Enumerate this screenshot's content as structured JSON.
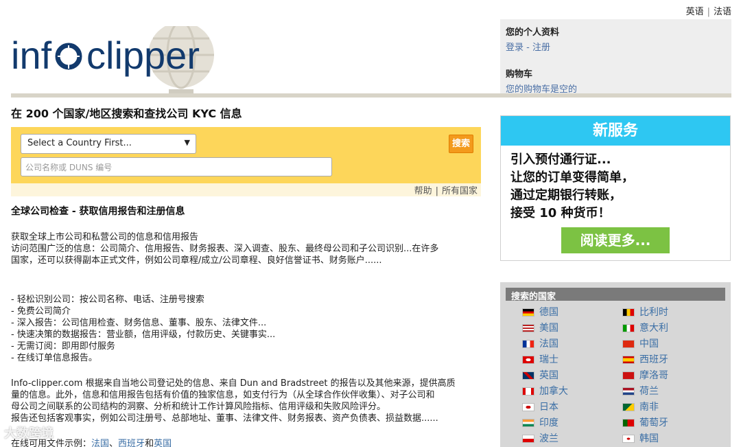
{
  "lang": {
    "english": "英语",
    "french": "法语"
  },
  "account": {
    "profile_label": "您的个人资料",
    "login": "登录",
    "register": "注册",
    "cart_label": "购物车",
    "cart_status": "您的购物车是空的"
  },
  "page_title": "在 200 个国家/地区搜索和查找公司 KYC 信息",
  "search": {
    "country_select": "Select a Country First...",
    "placeholder": "公司名称或 DUNS 编号",
    "button": "搜索",
    "help": "帮助",
    "all_countries": "所有国家"
  },
  "content": {
    "heading": "全球公司检查 - 获取信用报告和注册信息",
    "intro_lines": [
      "获取全球上市公司和私营公司的信息和信用报告",
      "访问范围广泛的信息：公司简介、信用报告、财务报表、深入调查、股东、最终母公司和子公司识别...在许多",
      "国家，还可以获得副本正式文件，例如公司章程/成立/公司章程、良好信誉证书、财务账户......"
    ],
    "bullets": [
      "- 轻松识别公司：按公司名称、电话、注册号搜索",
      "- 免费公司简介",
      "- 深入报告：公司信用检查、财务信息、董事、股东、法律文件...",
      "- 快速决策的数据报告：营业额，信用评级，付款历史、关键事实...",
      "- 无需订阅：即用即付服务",
      "- 在线订单信息报告。"
    ],
    "source_lines": [
      "Info-clipper.com 根据来自当地公司登记处的信息、来自 Dun and Bradstreet 的报告以及其他来源，提供高质",
      "量的信息。此外，信息和信用报告包括有价值的独家信息，如支付行为（从全球合作伙伴收集）、对子公司和",
      "母公司之间联系的公司结构的洞察、分析和统计工作计算风险指标、信用评级和失败风险评分。",
      "报告还包括客观事实，例如公司注册号、总部地址、董事、法律文件、财务报表、资产负债表、损益数据......"
    ],
    "samples_prefix": "在线可用文件示例：",
    "samples_france": "法国",
    "samples_sep": "、",
    "samples_spain": "西班牙",
    "samples_and": "和",
    "samples_uk": "英国"
  },
  "promo": {
    "header": "新服务",
    "lines": [
      "引入预付通行证...",
      "让您的订单变得简单，",
      "通过定期银行转账，",
      "接受 10 种货币！"
    ],
    "button": "阅读更多..."
  },
  "countries": {
    "header": "搜索的国家",
    "left": [
      "德国",
      "美国",
      "法国",
      "瑞士",
      "英国",
      "加拿大",
      "日本",
      "印度",
      "波兰"
    ],
    "right": [
      "比利时",
      "意大利",
      "中国",
      "西班牙",
      "摩洛哥",
      "荷兰",
      "南非",
      "葡萄牙",
      "韩国"
    ]
  },
  "watermark": "大数跨境",
  "colors": {
    "accent_yellow": "#fdd65a",
    "button_orange": "#f39a1c",
    "promo_blue": "#2ec7f2",
    "promo_green": "#7cc243",
    "link": "#3a6ea5"
  }
}
